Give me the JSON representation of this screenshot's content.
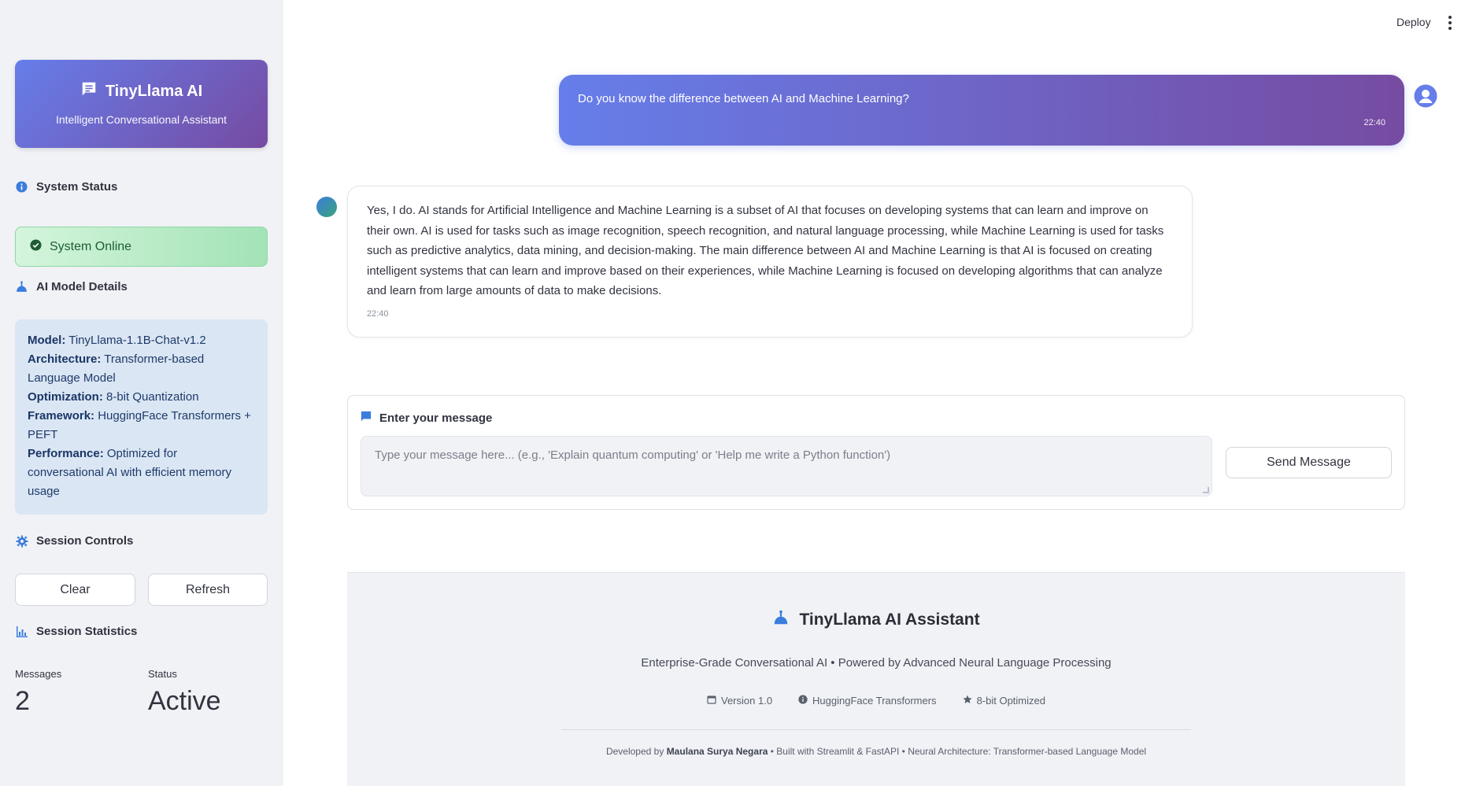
{
  "sidebar": {
    "brand": {
      "title": "TinyLlama AI",
      "subtitle": "Intelligent Conversational Assistant"
    },
    "system_status": {
      "heading": "System Status",
      "status_text": "System Online"
    },
    "model_details": {
      "heading": "AI Model Details",
      "items": [
        {
          "label": "Model:",
          "value": "TinyLlama-1.1B-Chat-v1.2"
        },
        {
          "label": "Architecture:",
          "value": "Transformer-based Language Model"
        },
        {
          "label": "Optimization:",
          "value": "8-bit Quantization"
        },
        {
          "label": "Framework:",
          "value": "HuggingFace Transformers + PEFT"
        },
        {
          "label": "Performance:",
          "value": "Optimized for conversational AI with efficient memory usage"
        }
      ]
    },
    "session_controls": {
      "heading": "Session Controls",
      "clear_label": "Clear",
      "refresh_label": "Refresh"
    },
    "session_statistics": {
      "heading": "Session Statistics",
      "messages_label": "Messages",
      "messages_value": "2",
      "status_label": "Status",
      "status_value": "Active"
    }
  },
  "header": {
    "deploy_label": "Deploy"
  },
  "chat": {
    "messages": [
      {
        "role": "user",
        "text": "Do you know the difference between AI and Machine Learning?",
        "time": "22:40"
      },
      {
        "role": "assistant",
        "text": "Yes, I do. AI stands for Artificial Intelligence and Machine Learning is a subset of AI that focuses on developing systems that can learn and improve on their own. AI is used for tasks such as image recognition, speech recognition, and natural language processing, while Machine Learning is used for tasks such as predictive analytics, data mining, and decision-making. The main difference between AI and Machine Learning is that AI is focused on creating intelligent systems that can learn and improve based on their experiences, while Machine Learning is focused on developing algorithms that can analyze and learn from large amounts of data to make decisions.",
        "time": "22:40"
      }
    ]
  },
  "input_form": {
    "label": "Enter your message",
    "placeholder": "Type your message here... (e.g., 'Explain quantum computing' or 'Help me write a Python function')",
    "send_label": "Send Message"
  },
  "footer": {
    "title": "TinyLlama AI Assistant",
    "subtitle": "Enterprise-Grade Conversational AI • Powered by Advanced Neural Language Processing",
    "badges": [
      "Version 1.0",
      "HuggingFace Transformers",
      "8-bit Optimized"
    ],
    "dev_prefix": "Developed by",
    "developer": "Maulana Surya Negara",
    "dev_suffix": "• Built with Streamlit & FastAPI • Neural Architecture: Transformer-based Language Model"
  },
  "colors": {
    "accent_start": "#667eea",
    "accent_end": "#764ba2",
    "success_bg": "#a3e3b6",
    "info_bg": "#dae6f3",
    "icon_blue": "#3b7ddd"
  }
}
